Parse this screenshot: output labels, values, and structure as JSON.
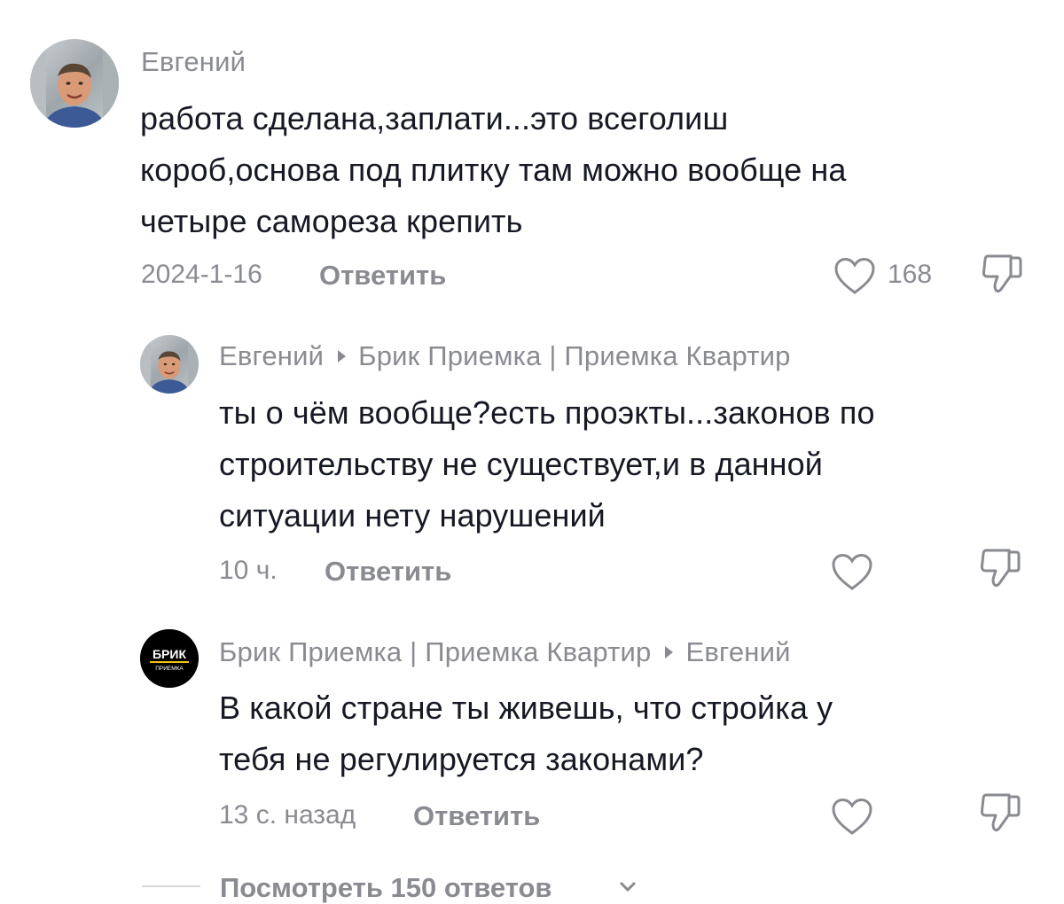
{
  "comments": [
    {
      "username": "Евгений",
      "text_lines": [
        "работа сделана,заплати...это всеголиш",
        "короб,основа под плитку там можно вообще на",
        "четыре самореза крепить"
      ],
      "time": "2024-1-16",
      "reply_label": "Ответить",
      "like_count": "168",
      "avatar_icon": "user-photo-avatar"
    },
    {
      "username_from": "Евгений",
      "username_to": "Брик Приемка | Приемка Квартир",
      "text_lines": [
        "ты о чём вообще?есть проэкты...законов по",
        "строительству не существует,и в данной",
        "ситуации нету нарушений"
      ],
      "time": "10 ч.",
      "reply_label": "Ответить",
      "avatar_icon": "user-photo-avatar"
    },
    {
      "username_from": "Брик Приемка | Приемка Квартир",
      "username_to": "Евгений",
      "text_lines": [
        "В какой стране ты живешь, что стройка у",
        "тебя не регулируется законами?"
      ],
      "time": "13 с. назад",
      "reply_label": "Ответить",
      "avatar_logo_top": "БРИК",
      "avatar_logo_bottom": "ПРИЕМКА",
      "avatar_icon": "brick-logo-avatar"
    }
  ],
  "view_replies_label": "Посмотреть 150 ответов",
  "colors": {
    "primary_text": "#161823",
    "secondary_text": "#8a8b91",
    "logo_accent": "#f2c200"
  }
}
